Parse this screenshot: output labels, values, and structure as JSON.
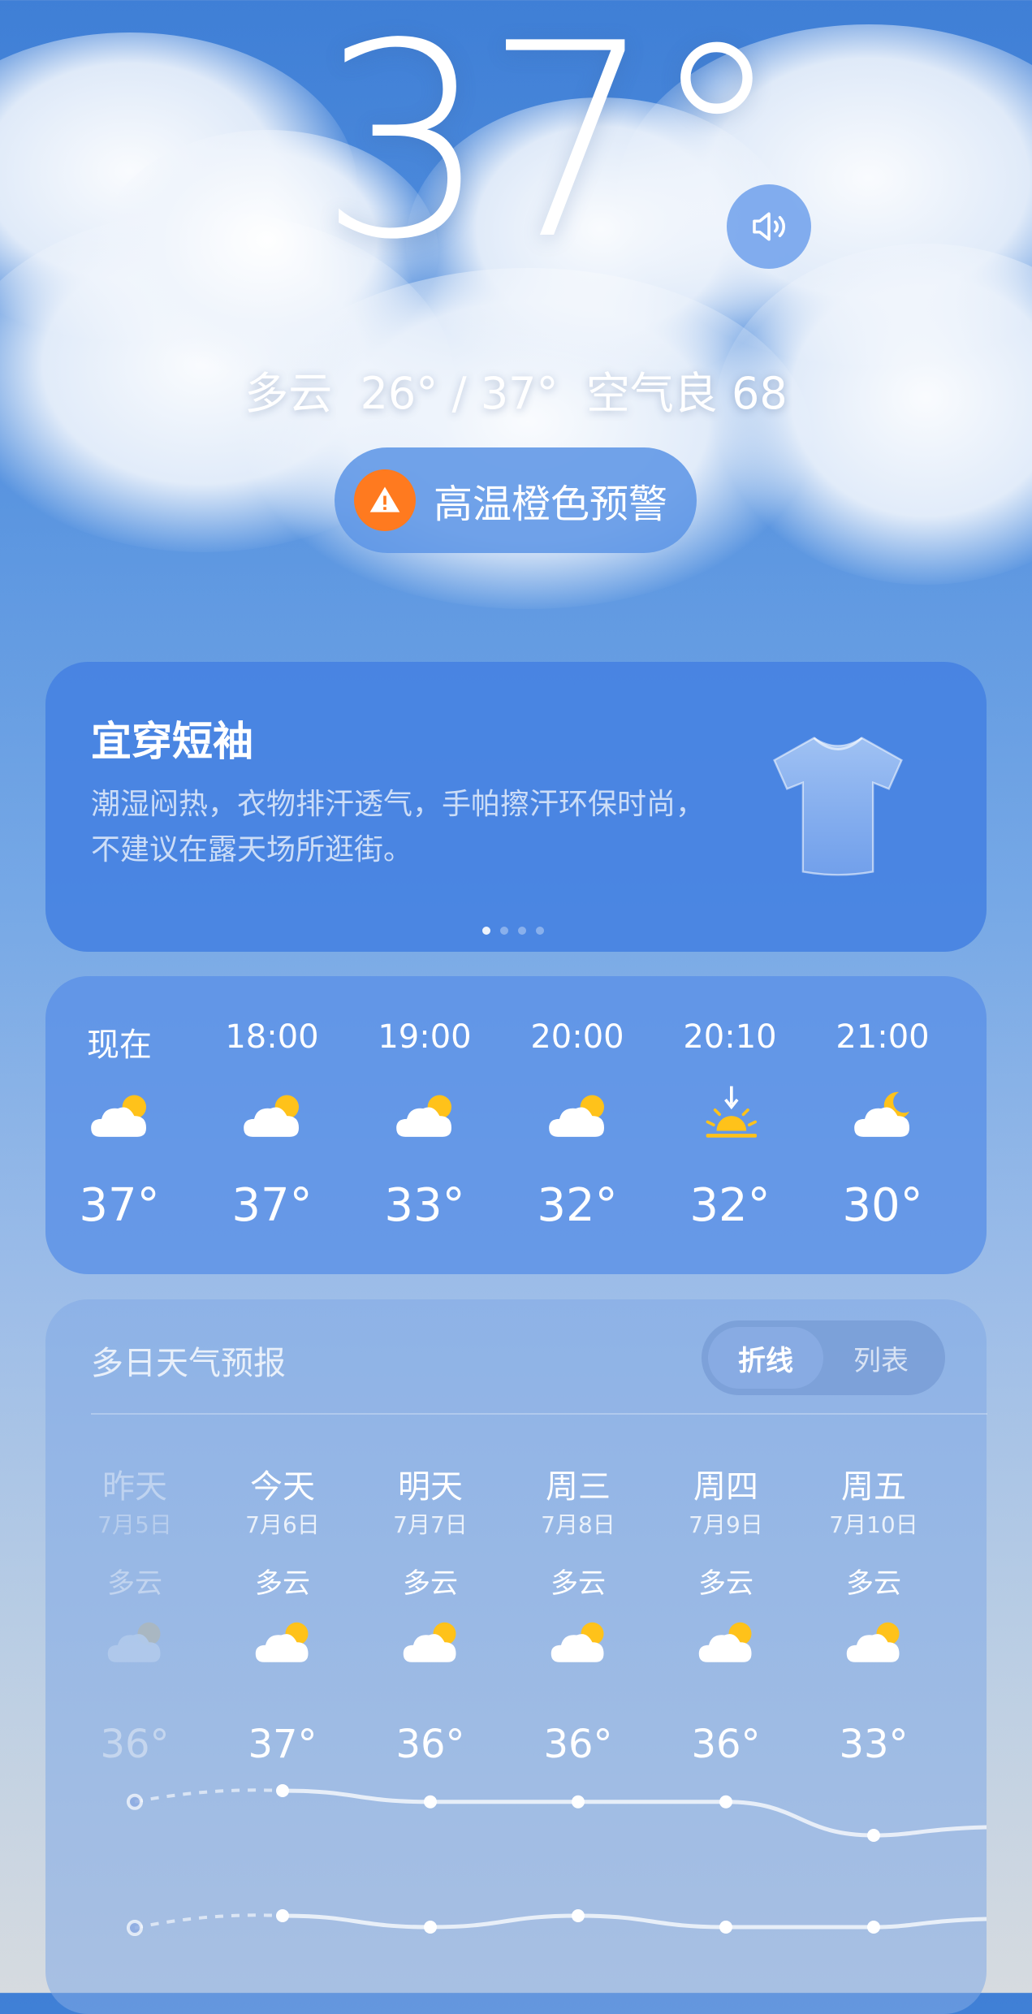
{
  "current": {
    "temperature": "37°",
    "summary": "多云  26° / 37°  空气良 68",
    "alert": "高温橙色预警"
  },
  "clothing": {
    "title": "宜穿短袖",
    "description": "潮湿闷热，衣物排汗透气，手帕擦汗环保时尚，不建议在露天场所逛街。",
    "page_index": 1,
    "page_count": 4
  },
  "hourly": [
    {
      "time": "现在",
      "icon": "cloudy-sun-icon",
      "temp": "37°"
    },
    {
      "time": "18:00",
      "icon": "cloudy-sun-icon",
      "temp": "37°"
    },
    {
      "time": "19:00",
      "icon": "cloudy-sun-icon",
      "temp": "33°"
    },
    {
      "time": "20:00",
      "icon": "cloudy-sun-icon",
      "temp": "32°"
    },
    {
      "time": "20:10",
      "icon": "sunset-icon",
      "temp": "32°"
    },
    {
      "time": "21:00",
      "icon": "cloudy-moon-icon",
      "temp": "30°"
    }
  ],
  "daily": {
    "title": "多日天气预报",
    "toggle_selected": "折线",
    "toggle_other": "列表",
    "days": [
      {
        "name": "昨天",
        "date": "7月5日",
        "cond": "多云",
        "high": "36°",
        "past": true
      },
      {
        "name": "今天",
        "date": "7月6日",
        "cond": "多云",
        "high": "37°",
        "past": false
      },
      {
        "name": "明天",
        "date": "7月7日",
        "cond": "多云",
        "high": "36°",
        "past": false
      },
      {
        "name": "周三",
        "date": "7月8日",
        "cond": "多云",
        "high": "36°",
        "past": false
      },
      {
        "name": "周四",
        "date": "7月9日",
        "cond": "多云",
        "high": "36°",
        "past": false
      },
      {
        "name": "周五",
        "date": "7月10日",
        "cond": "多云",
        "high": "33°",
        "past": false
      }
    ]
  },
  "colors": {
    "alert_orange": "#ff7a1f",
    "sun_yellow": "#ffc21a"
  }
}
